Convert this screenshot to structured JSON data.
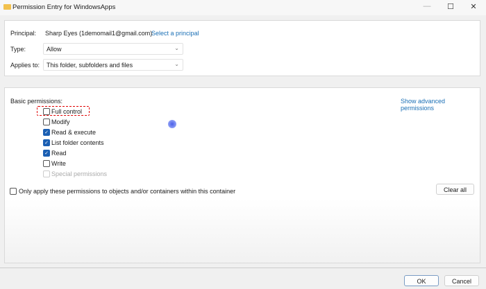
{
  "window": {
    "title": "Permission Entry for WindowsApps",
    "minimize": "—",
    "maximize": "☐",
    "close": "✕"
  },
  "principal": {
    "label": "Principal:",
    "value": "Sharp Eyes (1demomail1@gmail.com)",
    "link": "Select a principal"
  },
  "type": {
    "label": "Type:",
    "value": "Allow"
  },
  "applies_to": {
    "label": "Applies to:",
    "value": "This folder, subfolders and files"
  },
  "permissions": {
    "label": "Basic permissions:",
    "advanced_link": "Show advanced permissions",
    "items": [
      {
        "label": "Full control",
        "checked": false,
        "disabled": false,
        "highlighted": true
      },
      {
        "label": "Modify",
        "checked": false,
        "disabled": false
      },
      {
        "label": "Read & execute",
        "checked": true,
        "disabled": false
      },
      {
        "label": "List folder contents",
        "checked": true,
        "disabled": false
      },
      {
        "label": "Read",
        "checked": true,
        "disabled": false
      },
      {
        "label": "Write",
        "checked": false,
        "disabled": false
      },
      {
        "label": "Special permissions",
        "checked": false,
        "disabled": true
      }
    ]
  },
  "only_apply": {
    "label": "Only apply these permissions to objects and/or containers within this container",
    "checked": false
  },
  "buttons": {
    "clear_all": "Clear all",
    "ok": "OK",
    "cancel": "Cancel"
  },
  "colors": {
    "accent": "#1b5fb3",
    "link": "#1a6fb5",
    "highlight": "#e00000"
  }
}
